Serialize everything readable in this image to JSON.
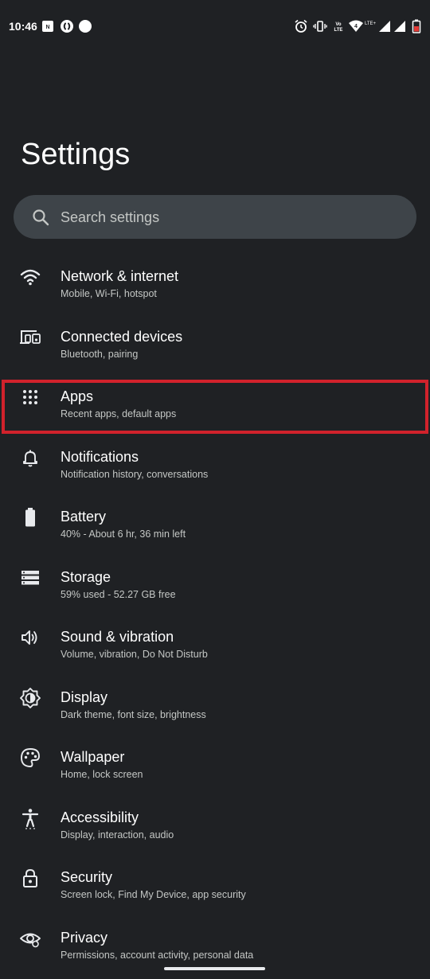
{
  "status_bar": {
    "time": "10:46",
    "notification_icons": [
      "nw-badge-icon",
      "shazam-icon",
      "dot-icon"
    ],
    "right_icons": [
      "alarm-icon",
      "vibrate-icon",
      "volte-icon",
      "wifi-icon",
      "signal-icon",
      "signal-icon",
      "battery-low-icon"
    ],
    "volte_label": "Vo LTE",
    "lte_label": "LTE+",
    "battery_color": "#e53935"
  },
  "page": {
    "title": "Settings"
  },
  "search": {
    "placeholder": "Search settings"
  },
  "items": [
    {
      "icon": "wifi-icon",
      "title": "Network & internet",
      "subtitle": "Mobile, Wi-Fi, hotspot"
    },
    {
      "icon": "connected-devices-icon",
      "title": "Connected devices",
      "subtitle": "Bluetooth, pairing"
    },
    {
      "icon": "apps-grid-icon",
      "title": "Apps",
      "subtitle": "Recent apps, default apps",
      "highlighted": true
    },
    {
      "icon": "bell-icon",
      "title": "Notifications",
      "subtitle": "Notification history, conversations"
    },
    {
      "icon": "battery-icon",
      "title": "Battery",
      "subtitle": "40% - About 6 hr, 36 min left"
    },
    {
      "icon": "storage-icon",
      "title": "Storage",
      "subtitle": "59% used - 52.27 GB free"
    },
    {
      "icon": "volume-icon",
      "title": "Sound & vibration",
      "subtitle": "Volume, vibration, Do Not Disturb"
    },
    {
      "icon": "display-brightness-icon",
      "title": "Display",
      "subtitle": "Dark theme, font size, brightness"
    },
    {
      "icon": "palette-icon",
      "title": "Wallpaper",
      "subtitle": "Home, lock screen"
    },
    {
      "icon": "accessibility-icon",
      "title": "Accessibility",
      "subtitle": "Display, interaction, audio"
    },
    {
      "icon": "lock-icon",
      "title": "Security",
      "subtitle": "Screen lock, Find My Device, app security"
    },
    {
      "icon": "eye-icon",
      "title": "Privacy",
      "subtitle": "Permissions, account activity, personal data"
    }
  ],
  "colors": {
    "background": "#1f2124",
    "search_background": "#3e4449",
    "highlight": "#d1222c"
  }
}
